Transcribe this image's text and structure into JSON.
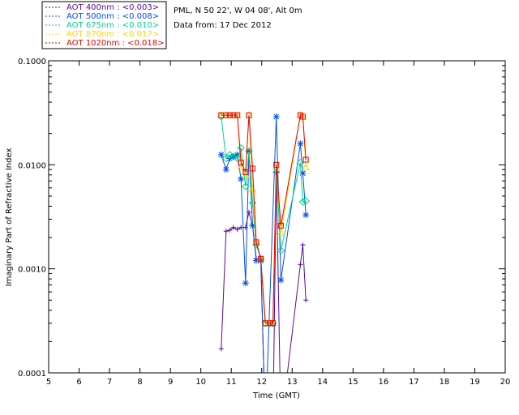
{
  "header": {
    "site_line": "PML, N 50 22', W 04 08', Alt 0m",
    "date_line": "Data from: 17 Dec 2012"
  },
  "chart_data": {
    "type": "line",
    "title": "",
    "xlabel": "Time (GMT)",
    "ylabel": "Imaginary Part of Refractive Index",
    "xlim": [
      5,
      20
    ],
    "ylim": [
      0.0001,
      0.1
    ],
    "y_scale": "log",
    "grid": false,
    "legend_placement": "top-left, above plot",
    "x_ticks": [
      "5",
      "6",
      "7",
      "8",
      "9",
      "10",
      "11",
      "12",
      "13",
      "14",
      "15",
      "16",
      "17",
      "18",
      "19",
      "20"
    ],
    "y_ticks": [
      {
        "value": 0.0001,
        "label": "0.0001"
      },
      {
        "value": 0.001,
        "label": "0.0010"
      },
      {
        "value": 0.01,
        "label": "0.0100"
      },
      {
        "value": 0.1,
        "label": "0.1000"
      }
    ],
    "series": [
      {
        "name": "AOT  400nm : <0.003>",
        "color": "#5a0a96",
        "marker": "plus",
        "x": [
          10.67,
          10.83,
          10.95,
          11.07,
          11.2,
          11.32,
          11.47,
          11.58,
          11.7,
          11.82,
          11.97,
          12.12,
          12.27,
          12.37,
          12.48,
          12.63,
          13.27,
          13.35,
          13.45
        ],
        "y": [
          0.00017,
          0.0023,
          0.00235,
          0.0025,
          0.0024,
          0.0025,
          0.0025,
          0.0035,
          0.0026,
          0.00125,
          0.00125,
          3e-05,
          3e-05,
          3e-05,
          0.0085,
          3e-05,
          0.0011,
          0.0017,
          0.0005
        ]
      },
      {
        "name": "AOT  500nm : <0.008>",
        "color": "#0050e6",
        "marker": "star",
        "x": [
          10.67,
          10.83,
          10.95,
          11.07,
          11.2,
          11.32,
          11.47,
          11.58,
          11.7,
          11.82,
          11.97,
          12.12,
          12.48,
          12.63,
          13.27,
          13.35,
          13.45
        ],
        "y": [
          0.0125,
          0.009,
          0.0115,
          0.012,
          0.0125,
          0.0073,
          0.00073,
          0.0135,
          0.0026,
          0.0012,
          0.0012,
          3e-05,
          0.029,
          0.00078,
          0.016,
          0.0083,
          0.0033
        ]
      },
      {
        "name": "AOT  675nm : <0.010>",
        "color": "#00d28c",
        "marker": "diamond",
        "x": [
          10.67,
          10.83,
          10.95,
          11.07,
          11.2,
          11.32,
          11.47,
          11.58,
          11.7,
          11.82,
          11.97,
          12.12,
          12.27,
          12.37,
          12.48,
          12.63,
          13.27,
          13.35,
          13.45
        ],
        "y": [
          0.029,
          0.0115,
          0.0125,
          0.012,
          0.0115,
          0.0145,
          0.0062,
          0.0135,
          0.0043,
          0.0017,
          0.00125,
          0.0003,
          0.0003,
          0.0003,
          0.0085,
          0.0015,
          0.0105,
          0.0044,
          0.0045
        ]
      },
      {
        "name": "AOT  870nm : <0.017>",
        "color": "#ffd400",
        "marker": "triangle",
        "x": [
          10.67,
          10.83,
          10.95,
          11.07,
          11.2,
          11.32,
          11.47,
          11.58,
          11.7,
          11.82,
          11.97,
          12.12,
          12.27,
          12.37,
          12.48,
          12.63,
          13.27,
          13.35,
          13.45
        ],
        "y": [
          0.03,
          0.03,
          0.03,
          0.03,
          0.03,
          0.0095,
          0.008,
          0.03,
          0.0058,
          0.0018,
          0.00125,
          0.0003,
          0.0003,
          0.0003,
          0.0095,
          0.0022,
          0.03,
          0.029,
          0.0095
        ]
      },
      {
        "name": "AOT 1020nm : <0.018>",
        "color": "#e60000",
        "marker": "square",
        "x": [
          10.67,
          10.83,
          10.95,
          11.07,
          11.2,
          11.32,
          11.47,
          11.58,
          11.7,
          11.82,
          11.97,
          12.12,
          12.27,
          12.37,
          12.48,
          12.63,
          13.27,
          13.35,
          13.45
        ],
        "y": [
          0.03,
          0.03,
          0.03,
          0.03,
          0.03,
          0.0105,
          0.0085,
          0.03,
          0.0092,
          0.0018,
          0.00125,
          0.0003,
          0.0003,
          0.0003,
          0.01,
          0.0026,
          0.03,
          0.029,
          0.0112
        ]
      }
    ]
  }
}
